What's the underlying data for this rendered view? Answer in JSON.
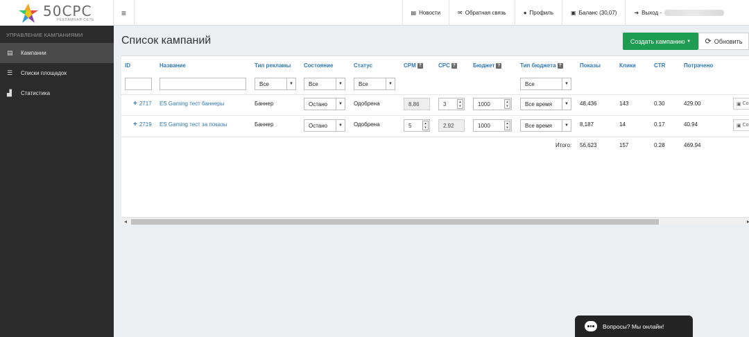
{
  "brand": {
    "name": "50CPC",
    "tagline": "РЕКЛАМНАЯ СЕТЬ"
  },
  "topnav": {
    "news": "Новости",
    "feedback": "Обратная связь",
    "profile": "Профиль",
    "balance": "Баланс (30,07)",
    "logout": "Выход -"
  },
  "sidebar": {
    "header": "Управление кампаниями",
    "items": [
      {
        "label": "Кампании",
        "active": true
      },
      {
        "label": "Списки площадок",
        "active": false
      },
      {
        "label": "Статистика",
        "active": false
      }
    ]
  },
  "page": {
    "title": "Список кампаний",
    "create_label": "Создать кампанию",
    "refresh_label": "Обновить"
  },
  "table": {
    "headers": {
      "id": "ID",
      "name": "Название",
      "ad_type": "Тип рекламы",
      "state": "Состояние",
      "status": "Статус",
      "cpm": "CPM",
      "cpc": "CPC",
      "budget": "Бюджет",
      "budget_type": "Тип бюджета",
      "impressions": "Показы",
      "clicks": "Клики",
      "ctr": "CTR",
      "spent": "Потрачено"
    },
    "filters": {
      "ad_type": "Все",
      "state": "Все",
      "status": "Все",
      "budget_type": "Все"
    },
    "rows": [
      {
        "id": "2717",
        "name": "ES Gaming тест баннеры",
        "ad_type": "Баннер",
        "state": "Остано",
        "status": "Одобрена",
        "cpm": "8.86",
        "cpc": "3",
        "budget": "1000",
        "budget_type": "Все время",
        "impressions": "48,436",
        "clicks": "143",
        "ctr": "0.30",
        "spent": "429.00",
        "action": "Со"
      },
      {
        "id": "2719",
        "name": "ES Gaming тест за показы",
        "ad_type": "Баннер",
        "state": "Остано",
        "status": "Одобрена",
        "cpm": "5",
        "cpc": "2.92",
        "budget": "1000",
        "budget_type": "Все время",
        "impressions": "8,187",
        "clicks": "14",
        "ctr": "0.17",
        "spent": "40.94",
        "action": "Со"
      }
    ],
    "totals": {
      "label": "Итого:",
      "impressions": "56,623",
      "clicks": "157",
      "ctr": "0.28",
      "spent": "469.94"
    }
  },
  "chat": {
    "label": "Вопросы? Мы онлайн!"
  },
  "colors": {
    "accent_green": "#1e9c52",
    "link_blue": "#2f79b8",
    "sidebar_bg": "#2b2b2b"
  }
}
